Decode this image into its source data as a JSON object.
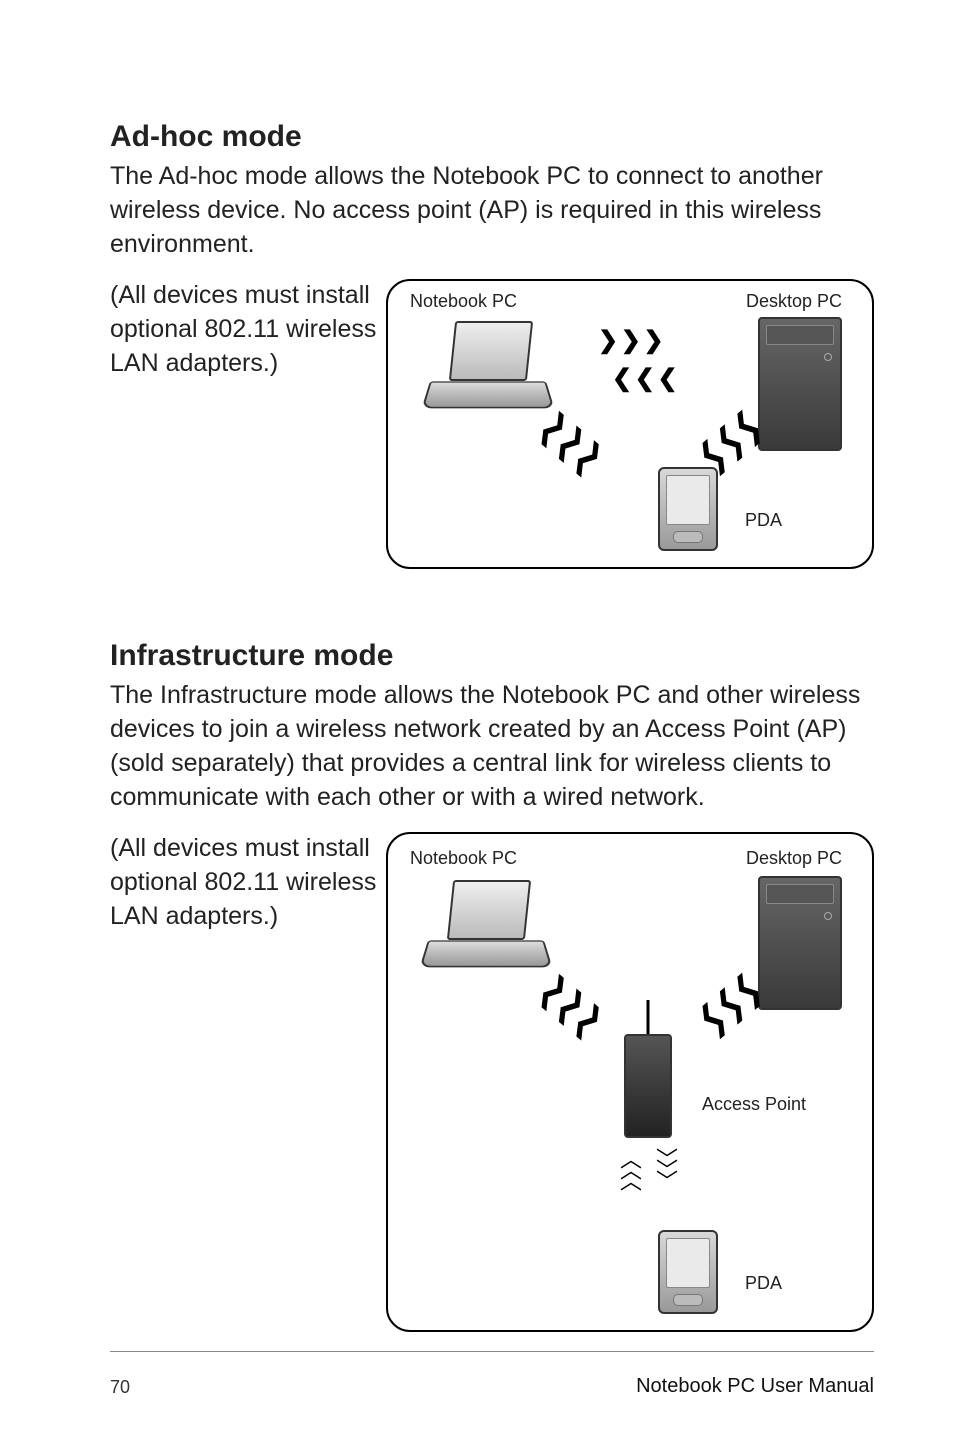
{
  "page": {
    "number": "70",
    "manual": "Notebook PC User Manual"
  },
  "adhoc": {
    "heading": "Ad-hoc mode",
    "intro": "The Ad-hoc mode allows the Notebook PC to connect to another wireless device. No access point (AP) is required in this wireless environment.",
    "side": "(All devices must install optional 802.11 wireless LAN adapters.)",
    "labels": {
      "notebook": "Notebook PC",
      "desktop": "Desktop PC",
      "pda": "PDA"
    }
  },
  "infra": {
    "heading": "Infrastructure mode",
    "intro": "The Infrastructure mode allows the Notebook PC and other wireless devices to join a wireless network created by an Access Point (AP) (sold separately) that provides a central link for wireless clients to communicate with each other or with a wired network.",
    "side": "(All devices must install optional 802.11 wireless LAN adapters.)",
    "labels": {
      "notebook": "Notebook PC",
      "desktop": "Desktop PC",
      "pda": "PDA",
      "ap": "Access Point"
    }
  }
}
